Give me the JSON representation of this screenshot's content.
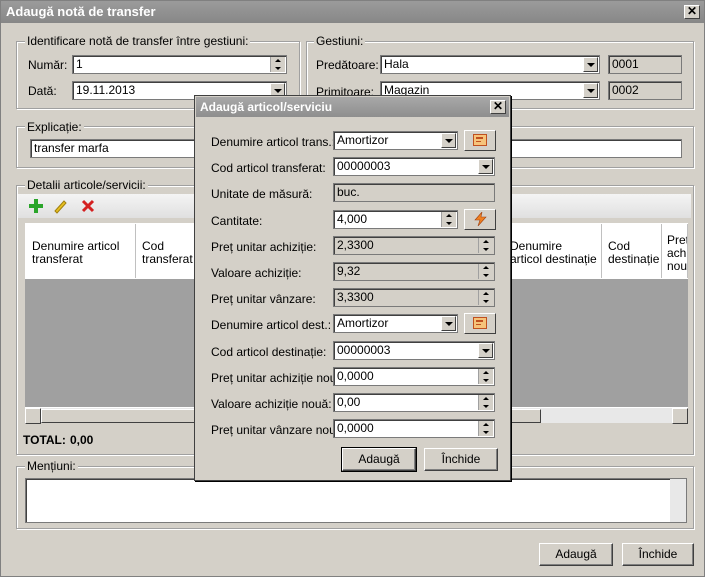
{
  "window": {
    "title": "Adaugă notă de transfer"
  },
  "ident": {
    "group_label": "Identificare notă de transfer între gestiuni:",
    "numar_label": "Număr:",
    "numar_value": "1",
    "data_label": "Dată:",
    "data_value": "19.11.2013"
  },
  "gestiuni": {
    "group_label": "Gestiuni:",
    "predatoare_label": "Predătoare:",
    "predatoare_value": "Hala",
    "predatoare_code": "0001",
    "primitoare_label": "Primitoare:",
    "primitoare_value": "Magazin",
    "primitoare_code": "0002"
  },
  "explicatie": {
    "group_label": "Explicație:",
    "value": "transfer marfa"
  },
  "detalii": {
    "group_label": "Detalii articole/servicii:",
    "columns": [
      "Denumire articol transferat",
      "Cod transferat",
      "Denumire articol destinație",
      "Cod destinație",
      "Preț achiziție nou"
    ],
    "total_label": "TOTAL:",
    "total_value": "0,00"
  },
  "mentiuni": {
    "group_label": "Mențiuni:"
  },
  "buttons": {
    "adauga": "Adaugă",
    "inchide": "Închide"
  },
  "dialog": {
    "title": "Adaugă articol/serviciu",
    "rows": [
      {
        "label": "Denumire articol trans.:",
        "value": "Amortizor"
      },
      {
        "label": "Cod articol transferat:",
        "value": "00000003"
      },
      {
        "label": "Unitate de măsură:",
        "value": "buc."
      },
      {
        "label": "Cantitate:",
        "value": "4,000"
      },
      {
        "label": "Preț unitar achiziție:",
        "value": "2,3300"
      },
      {
        "label": "Valoare achiziție:",
        "value": "9,32"
      },
      {
        "label": "Preț unitar vânzare:",
        "value": "3,3300"
      },
      {
        "label": "Denumire articol dest.:",
        "value": "Amortizor"
      },
      {
        "label": "Cod articol destinație:",
        "value": "00000003"
      },
      {
        "label": "Preț unitar achiziție nou:",
        "value": "0,0000"
      },
      {
        "label": "Valoare achiziție nouă:",
        "value": "0,00"
      },
      {
        "label": "Preț unitar vânzare nou:",
        "value": "0,0000"
      }
    ],
    "adauga": "Adaugă",
    "inchide": "Închide"
  }
}
